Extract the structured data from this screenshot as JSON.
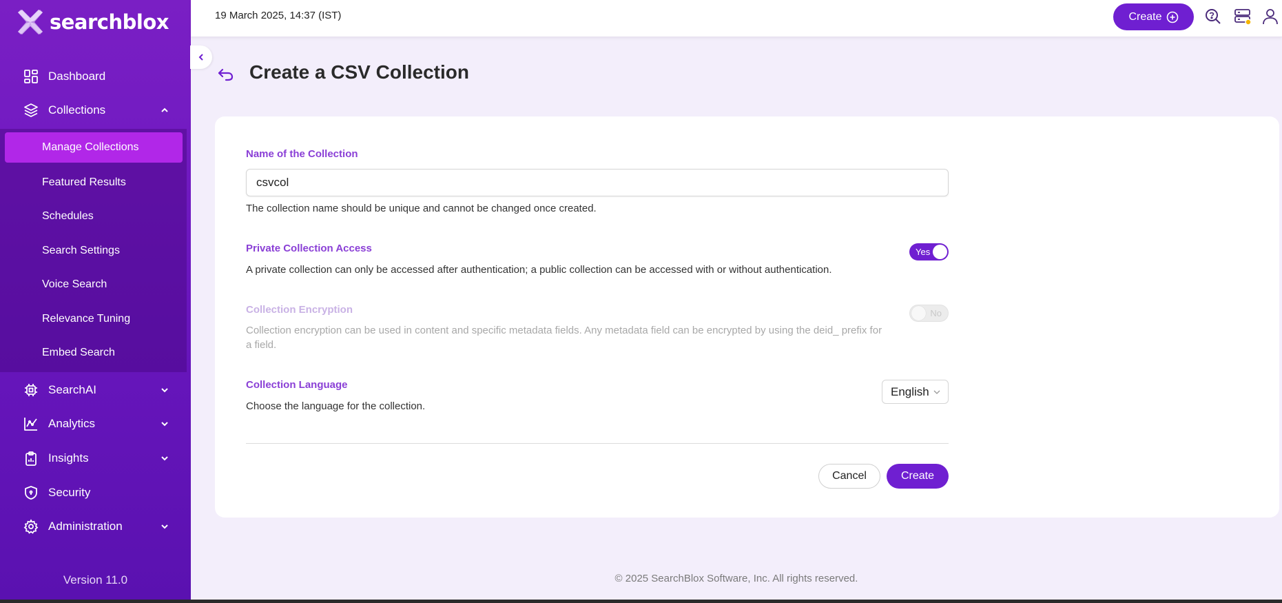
{
  "app": {
    "logo_text": "searchblox",
    "version": "Version 11.0"
  },
  "sidebar": {
    "items": [
      {
        "label": "Dashboard",
        "icon": "dashboard-icon"
      },
      {
        "label": "Collections",
        "icon": "layers-icon",
        "expanded": true
      },
      {
        "label": "SearchAI",
        "icon": "chip-icon"
      },
      {
        "label": "Analytics",
        "icon": "chart-icon"
      },
      {
        "label": "Insights",
        "icon": "clipboard-icon"
      },
      {
        "label": "Security",
        "icon": "shield-icon"
      },
      {
        "label": "Administration",
        "icon": "gear-icon"
      }
    ],
    "collections_sub": [
      {
        "label": "Manage Collections",
        "active": true
      },
      {
        "label": "Featured Results"
      },
      {
        "label": "Schedules"
      },
      {
        "label": "Search Settings"
      },
      {
        "label": "Voice Search"
      },
      {
        "label": "Relevance Tuning"
      },
      {
        "label": "Embed Search"
      }
    ]
  },
  "topbar": {
    "datetime": "19 March 2025, 14:37 (IST)",
    "create_label": "Create",
    "icons": [
      "search-help-icon",
      "server-status-icon",
      "user-icon"
    ]
  },
  "page": {
    "title": "Create a CSV Collection"
  },
  "form": {
    "name_label": "Name of the Collection",
    "name_value": "csvcol",
    "name_help": "The collection name should be unique and cannot be changed once created.",
    "private_label": "Private Collection Access",
    "private_help": "A private collection can only be accessed after authentication; a public collection can be accessed with or without authentication.",
    "private_toggle": "Yes",
    "encryption_label": "Collection Encryption",
    "encryption_help": "Collection encryption can be used in content and specific metadata fields. Any metadata field can be encrypted by using the deid_ prefix for a field.",
    "encryption_toggle": "No",
    "language_label": "Collection Language",
    "language_help": "Choose the language for the collection.",
    "language_value": "English",
    "cancel_label": "Cancel",
    "create_label": "Create"
  },
  "footer": {
    "copyright": "© 2025 SearchBlox Software, Inc. All rights reserved."
  },
  "colors": {
    "brand": "#6f1fd1",
    "sidebar_active": "#b127e8",
    "label": "#8a3fd6",
    "background": "#f3eefb"
  }
}
